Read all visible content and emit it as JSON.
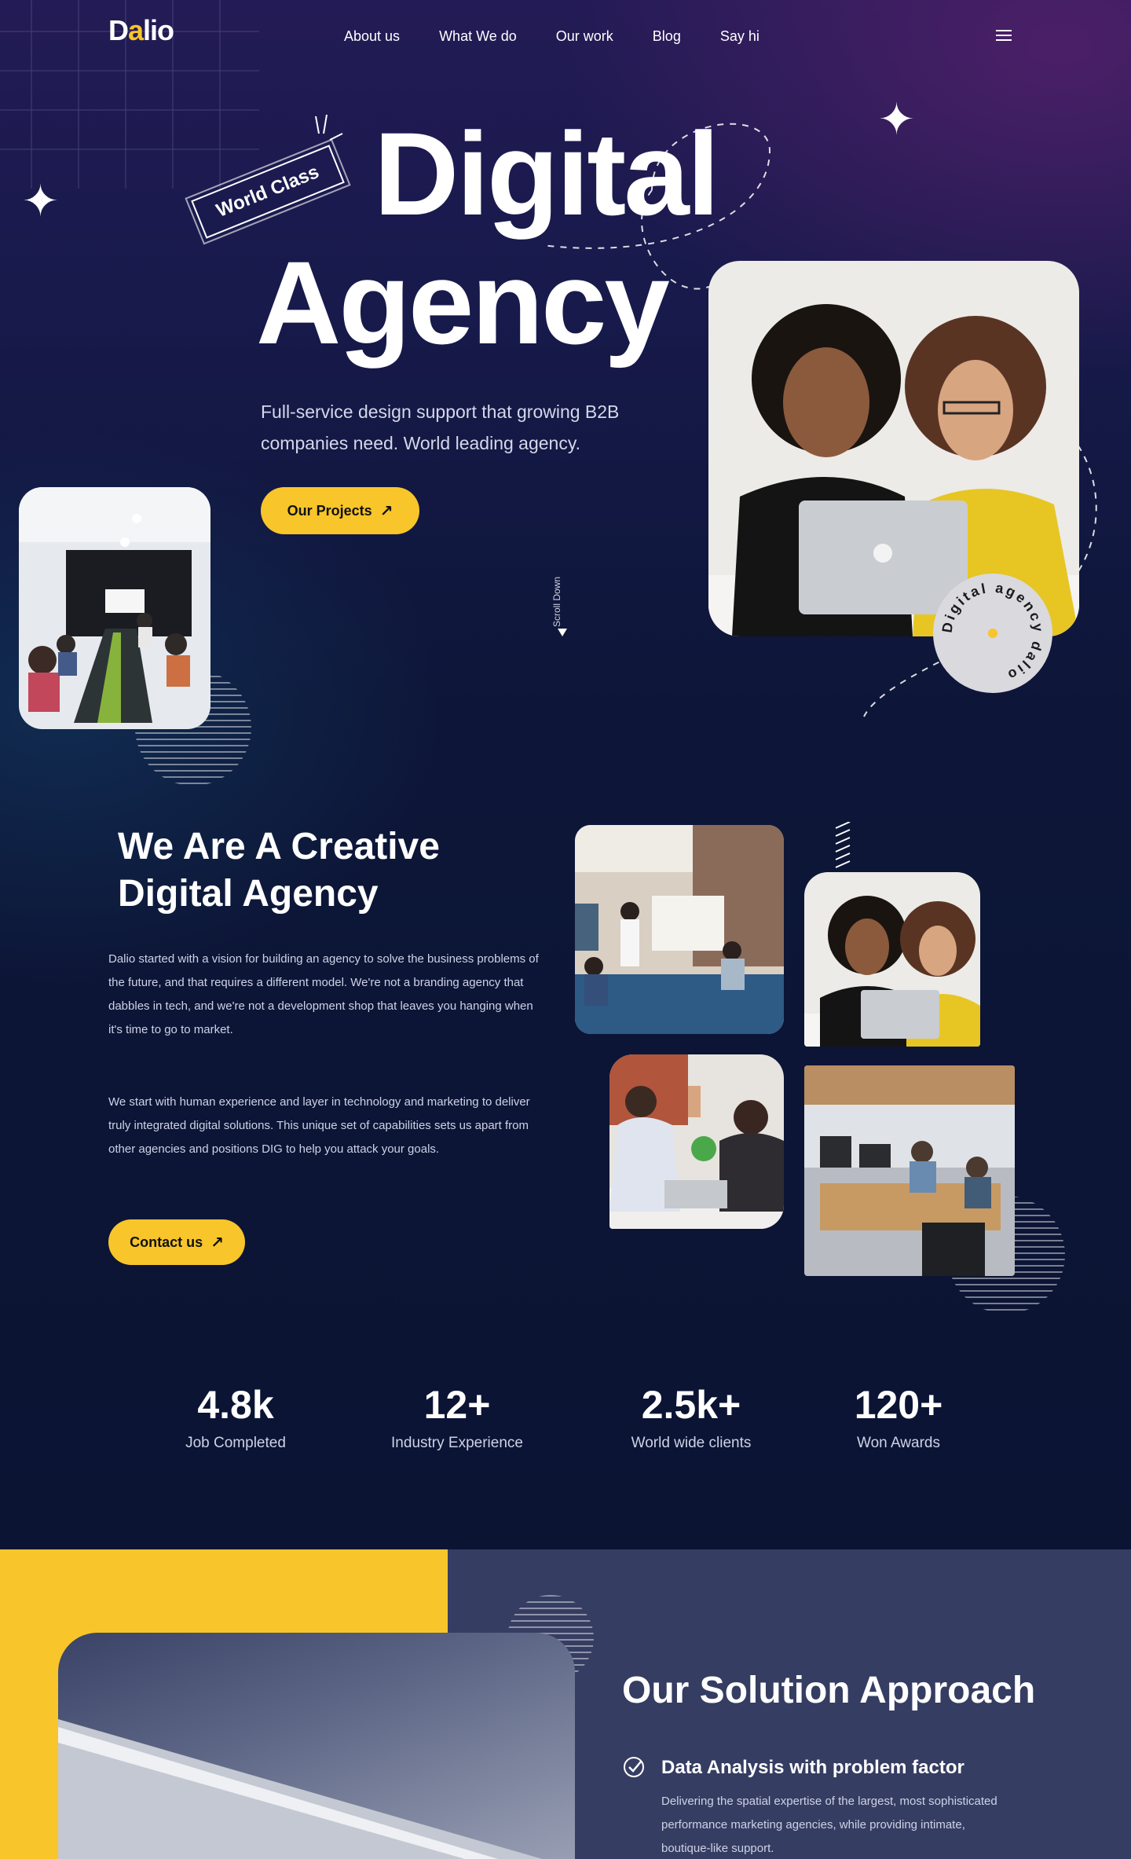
{
  "brand": {
    "logo_text_1": "D",
    "logo_text_dot": "a",
    "logo_text_2": "lio",
    "accent_color": "#f8c52a"
  },
  "nav": {
    "items": [
      {
        "label": "About us"
      },
      {
        "label": "What We do"
      },
      {
        "label": "Our work"
      },
      {
        "label": "Blog"
      },
      {
        "label": "Say hi"
      }
    ],
    "menu_icon": "hamburger-icon"
  },
  "hero": {
    "title_line_1": "Digital",
    "title_line_2": "Agency",
    "badge": "World Class",
    "description": "Full-service design support that growing B2B companies need. World leading agency.",
    "cta_label": "Our Projects",
    "cta_icon": "arrow-up-right-icon",
    "scroll_label": "Scroll Down",
    "stamp_text": "Digital agency dalio"
  },
  "about": {
    "title": "We Are A Creative Digital Agency",
    "paragraph_1": "Dalio started with a vision for building an agency to solve the business problems of the future, and that requires a different model. We're not a branding agency that dabbles in tech, and we're not a development shop that leaves you hanging when it's time to go to market.",
    "paragraph_2": "We start with human experience and layer in technology and marketing to deliver truly integrated digital solutions. This unique set of capabilities sets us apart from other agencies and positions DIG to help you attack your goals.",
    "cta_label": "Contact us",
    "cta_icon": "arrow-up-right-icon"
  },
  "stats": [
    {
      "value": "4.8k",
      "label": "Job Completed"
    },
    {
      "value": "12+",
      "label": "Industry Experience"
    },
    {
      "value": "2.5k+",
      "label": "World wide clients"
    },
    {
      "value": "120+",
      "label": "Won Awards"
    }
  ],
  "solution": {
    "title": "Our Solution Approach",
    "items": [
      {
        "icon": "check-circle-icon",
        "title": "Data Analysis with problem factor",
        "description": "Delivering the spatial expertise of the largest, most sophisticated performance marketing agencies, while providing intimate, boutique-like support."
      }
    ]
  }
}
